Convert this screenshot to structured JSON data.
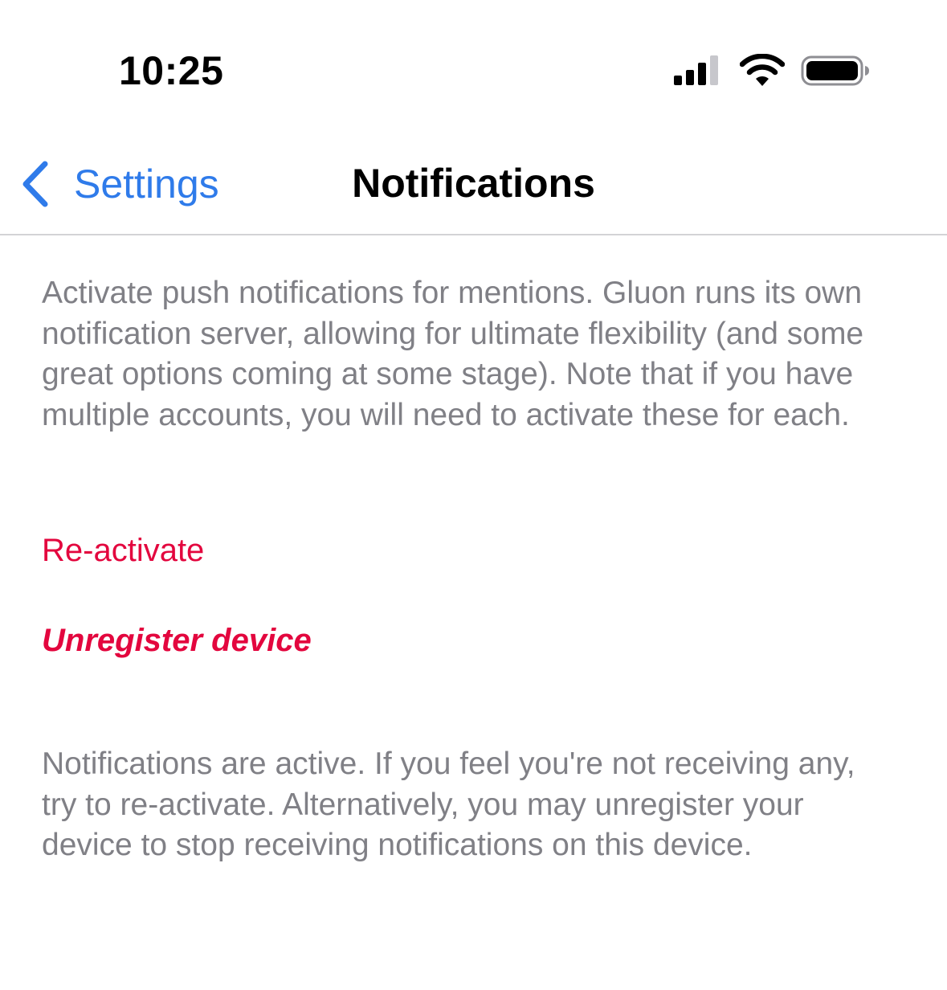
{
  "status_bar": {
    "time": "10:25",
    "icons": [
      "cellular-signal-icon",
      "wifi-icon",
      "battery-icon"
    ]
  },
  "nav": {
    "back_label": "Settings",
    "title": "Notifications"
  },
  "content": {
    "intro": "Activate push notifications for mentions. Gluon runs its own notification server, allowing for ultimate flexibility (and some great options coming at some stage). Note that if you have multiple accounts, you will need to activate these for each.",
    "reactivate_label": "Re-activate",
    "unregister_label": "Unregister device",
    "status_message": "Notifications are active. If you feel you're not receiving any, try to re-activate. Alternatively, you may unregister your device to stop receiving notifications on this device."
  },
  "colors": {
    "accent_blue": "#2f7bea",
    "action_red": "#e3063e",
    "secondary_text": "#808086",
    "separator": "#d3d3d6"
  }
}
